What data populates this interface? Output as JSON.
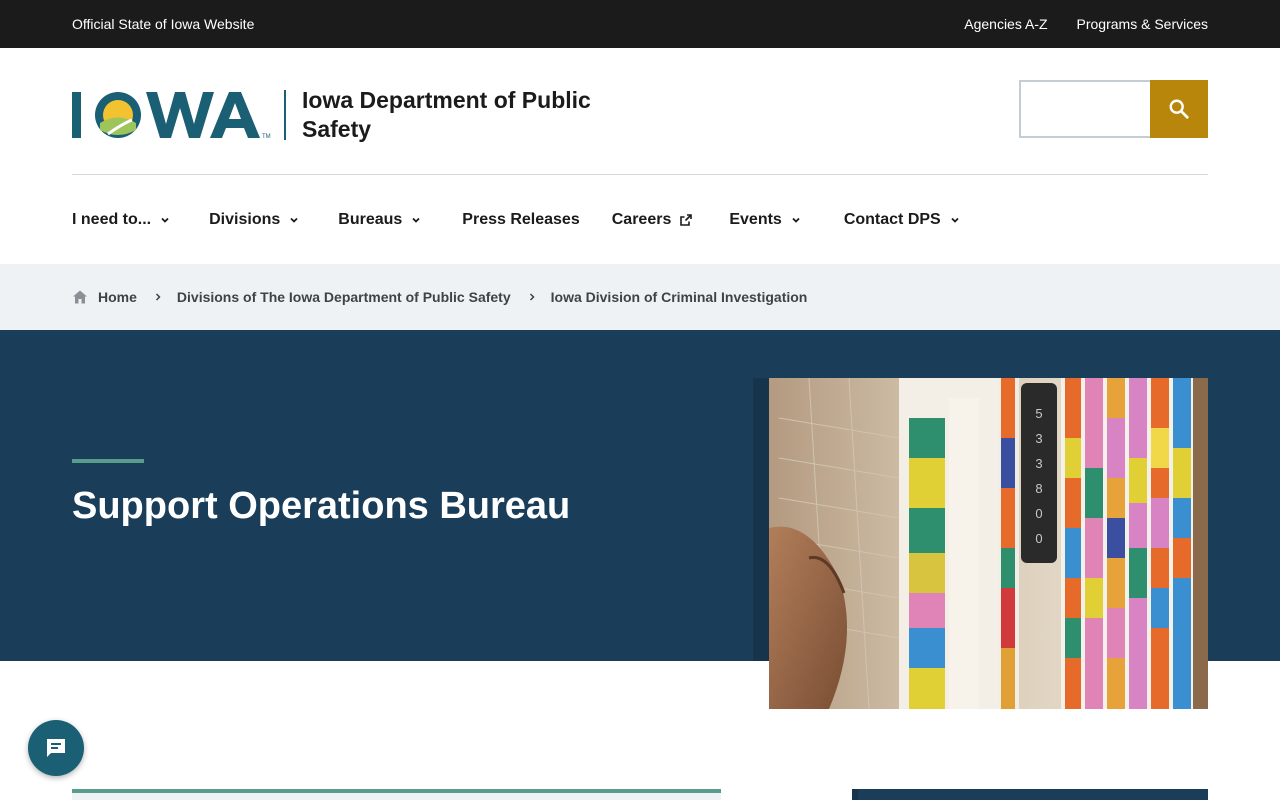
{
  "topbar": {
    "official": "Official State of Iowa Website",
    "links": [
      "Agencies A-Z",
      "Programs & Services"
    ]
  },
  "header": {
    "logo_text": "IOWA",
    "logo_tm": "TM",
    "dept_name": "Iowa Department of Public Safety",
    "search_placeholder": "",
    "search_icon": "search-icon"
  },
  "nav": {
    "items": [
      {
        "label": "I need to...",
        "icon": "chevron-down-icon"
      },
      {
        "label": "Divisions",
        "icon": "chevron-down-icon"
      },
      {
        "label": "Bureaus",
        "icon": "chevron-down-icon"
      },
      {
        "label": "Press Releases",
        "icon": ""
      },
      {
        "label": "Careers",
        "icon": "external-link-icon"
      },
      {
        "label": "Events",
        "icon": "chevron-down-icon"
      },
      {
        "label": "Contact DPS",
        "icon": "chevron-down-icon"
      }
    ]
  },
  "breadcrumb": {
    "items": [
      "Home",
      "Divisions of The Iowa Department of Public Safety",
      "Iowa Division of Criminal Investigation"
    ]
  },
  "hero": {
    "title": "Support Operations Bureau",
    "image_tab_label": "533800"
  },
  "colors": {
    "topbar_bg": "#1b1b1b",
    "brand_teal": "#1a5f73",
    "search_gold": "#b8860b",
    "hero_navy": "#1a3d59",
    "accent_green": "#5a9c8c",
    "breadcrumb_bg": "#eff2f4"
  },
  "chat": {
    "icon": "chat-icon"
  }
}
